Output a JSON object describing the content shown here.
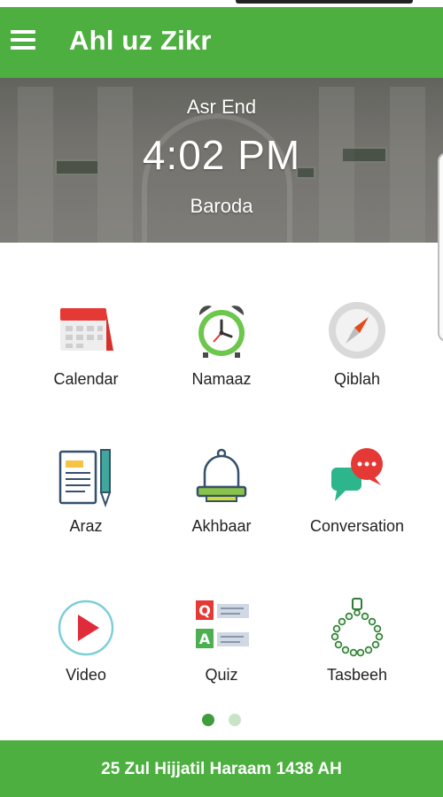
{
  "app": {
    "title": "Ahl uz Zikr"
  },
  "prayer": {
    "label": "Asr End",
    "time": "4:02 PM",
    "city": "Baroda"
  },
  "menu": [
    {
      "label": "Calendar",
      "icon": "calendar-icon"
    },
    {
      "label": "Namaaz",
      "icon": "alarm-clock-icon"
    },
    {
      "label": "Qiblah",
      "icon": "compass-icon"
    },
    {
      "label": "Araz",
      "icon": "document-pen-icon"
    },
    {
      "label": "Akhbaar",
      "icon": "bell-icon"
    },
    {
      "label": "Conversation",
      "icon": "chat-bubbles-icon"
    },
    {
      "label": "Video",
      "icon": "play-icon"
    },
    {
      "label": "Quiz",
      "icon": "quiz-qa-icon"
    },
    {
      "label": "Tasbeeh",
      "icon": "prayer-beads-icon"
    }
  ],
  "pager": {
    "pages": 2,
    "current": 1
  },
  "footer": {
    "hijri_date": "25 Zul Hijjatil Haraam 1438 AH"
  },
  "colors": {
    "primary": "#4caf3f",
    "dot_active": "#3f9d3e",
    "dot_inactive": "#c8e3c6"
  }
}
